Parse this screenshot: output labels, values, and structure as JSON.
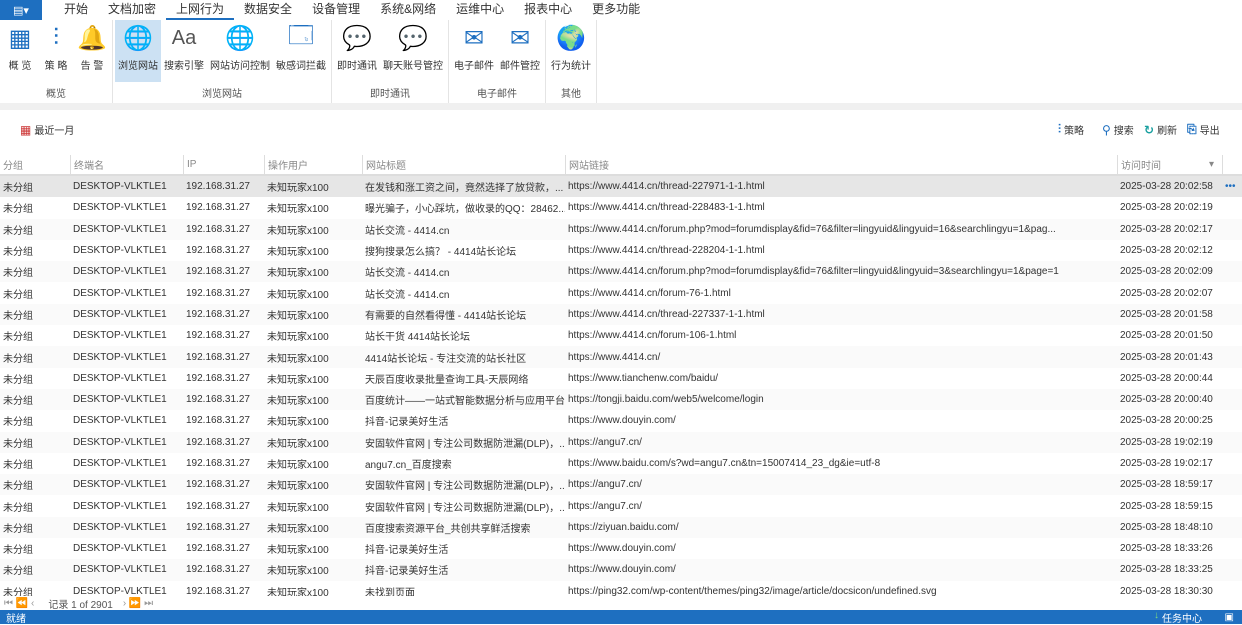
{
  "menu": {
    "items": [
      "开始",
      "文档加密",
      "上网行为",
      "数据安全",
      "设备管理",
      "系统&网络",
      "运维中心",
      "报表中心",
      "更多功能"
    ],
    "active": "上网行为"
  },
  "ribbon": {
    "groups": [
      {
        "label": "概览",
        "buttons": [
          {
            "label": "概 览",
            "icon": "grid-icon"
          },
          {
            "label": "策 略",
            "icon": "sliders-icon"
          },
          {
            "label": "告 警",
            "icon": "bell-icon"
          }
        ]
      },
      {
        "label": "浏览网站",
        "buttons": [
          {
            "label": "浏览网站",
            "icon": "globe-icon"
          },
          {
            "label": "搜索引擎",
            "icon": "font-icon"
          },
          {
            "label": "网站访问控制",
            "icon": "globe-check-icon"
          },
          {
            "label": "敏感词拦截",
            "icon": "shield-page-icon"
          }
        ]
      },
      {
        "label": "即时通讯",
        "buttons": [
          {
            "label": "即时通讯",
            "icon": "chat-icon"
          },
          {
            "label": "聊天账号管控",
            "icon": "chat-user-icon"
          }
        ]
      },
      {
        "label": "电子邮件",
        "buttons": [
          {
            "label": "电子邮件",
            "icon": "mail-icon"
          },
          {
            "label": "邮件管控",
            "icon": "mail-shield-icon"
          }
        ]
      },
      {
        "label": "其他",
        "buttons": [
          {
            "label": "行为统计",
            "icon": "stats-globe-icon"
          }
        ]
      }
    ]
  },
  "toolbar": {
    "date_range": "最近一月",
    "policy": "策略",
    "search": "搜索",
    "refresh": "刷新",
    "export": "导出"
  },
  "table": {
    "columns": [
      "分组",
      "终端名",
      "IP",
      "操作用户",
      "网站标题",
      "网站链接",
      "访问时间"
    ],
    "rows": [
      [
        "未分组",
        "DESKTOP-VLKTLE1",
        "192.168.31.27",
        "未知玩家x100",
        "在发钱和涨工资之间，竟然选择了放贷款，...",
        "https://www.4414.cn/thread-227971-1-1.html",
        "2025-03-28 20:02:58"
      ],
      [
        "未分组",
        "DESKTOP-VLKTLE1",
        "192.168.31.27",
        "未知玩家x100",
        "曝光骗子，小心踩坑，做收录的QQ：28462...",
        "https://www.4414.cn/thread-228483-1-1.html",
        "2025-03-28 20:02:19"
      ],
      [
        "未分组",
        "DESKTOP-VLKTLE1",
        "192.168.31.27",
        "未知玩家x100",
        "站长交流 - 4414.cn",
        "https://www.4414.cn/forum.php?mod=forumdisplay&fid=76&filter=lingyuid&lingyuid=16&searchlingyu=1&pag...",
        "2025-03-28 20:02:17"
      ],
      [
        "未分组",
        "DESKTOP-VLKTLE1",
        "192.168.31.27",
        "未知玩家x100",
        "搜狗搜录怎么搞？ - 4414站长论坛",
        "https://www.4414.cn/thread-228204-1-1.html",
        "2025-03-28 20:02:12"
      ],
      [
        "未分组",
        "DESKTOP-VLKTLE1",
        "192.168.31.27",
        "未知玩家x100",
        "站长交流 - 4414.cn",
        "https://www.4414.cn/forum.php?mod=forumdisplay&fid=76&filter=lingyuid&lingyuid=3&searchlingyu=1&page=1",
        "2025-03-28 20:02:09"
      ],
      [
        "未分组",
        "DESKTOP-VLKTLE1",
        "192.168.31.27",
        "未知玩家x100",
        "站长交流 - 4414.cn",
        "https://www.4414.cn/forum-76-1.html",
        "2025-03-28 20:02:07"
      ],
      [
        "未分组",
        "DESKTOP-VLKTLE1",
        "192.168.31.27",
        "未知玩家x100",
        "有需要的自然看得懂 - 4414站长论坛",
        "https://www.4414.cn/thread-227337-1-1.html",
        "2025-03-28 20:01:58"
      ],
      [
        "未分组",
        "DESKTOP-VLKTLE1",
        "192.168.31.27",
        "未知玩家x100",
        "站长干货  4414站长论坛",
        "https://www.4414.cn/forum-106-1.html",
        "2025-03-28 20:01:50"
      ],
      [
        "未分组",
        "DESKTOP-VLKTLE1",
        "192.168.31.27",
        "未知玩家x100",
        "4414站长论坛 - 专注交流的站长社区",
        "https://www.4414.cn/",
        "2025-03-28 20:01:43"
      ],
      [
        "未分组",
        "DESKTOP-VLKTLE1",
        "192.168.31.27",
        "未知玩家x100",
        "天辰百度收录批量查询工具-天辰网络",
        "https://www.tianchenw.com/baidu/",
        "2025-03-28 20:00:44"
      ],
      [
        "未分组",
        "DESKTOP-VLKTLE1",
        "192.168.31.27",
        "未知玩家x100",
        "百度统计——一站式智能数据分析与应用平台",
        "https://tongji.baidu.com/web5/welcome/login",
        "2025-03-28 20:00:40"
      ],
      [
        "未分组",
        "DESKTOP-VLKTLE1",
        "192.168.31.27",
        "未知玩家x100",
        "抖音-记录美好生活",
        "https://www.douyin.com/",
        "2025-03-28 20:00:25"
      ],
      [
        "未分组",
        "DESKTOP-VLKTLE1",
        "192.168.31.27",
        "未知玩家x100",
        "安固软件官网 | 专注公司数据防泄漏(DLP)，...",
        "https://angu7.cn/",
        "2025-03-28 19:02:19"
      ],
      [
        "未分组",
        "DESKTOP-VLKTLE1",
        "192.168.31.27",
        "未知玩家x100",
        "angu7.cn_百度搜索",
        "https://www.baidu.com/s?wd=angu7.cn&tn=15007414_23_dg&ie=utf-8",
        "2025-03-28 19:02:17"
      ],
      [
        "未分组",
        "DESKTOP-VLKTLE1",
        "192.168.31.27",
        "未知玩家x100",
        "安固软件官网 | 专注公司数据防泄漏(DLP)，...",
        "https://angu7.cn/",
        "2025-03-28 18:59:17"
      ],
      [
        "未分组",
        "DESKTOP-VLKTLE1",
        "192.168.31.27",
        "未知玩家x100",
        "安固软件官网 | 专注公司数据防泄漏(DLP)，...",
        "https://angu7.cn/",
        "2025-03-28 18:59:15"
      ],
      [
        "未分组",
        "DESKTOP-VLKTLE1",
        "192.168.31.27",
        "未知玩家x100",
        "百度搜索资源平台_共创共享鲜活搜索",
        "https://ziyuan.baidu.com/",
        "2025-03-28 18:48:10"
      ],
      [
        "未分组",
        "DESKTOP-VLKTLE1",
        "192.168.31.27",
        "未知玩家x100",
        "抖音-记录美好生活",
        "https://www.douyin.com/",
        "2025-03-28 18:33:26"
      ],
      [
        "未分组",
        "DESKTOP-VLKTLE1",
        "192.168.31.27",
        "未知玩家x100",
        "抖音-记录美好生活",
        "https://www.douyin.com/",
        "2025-03-28 18:33:25"
      ],
      [
        "未分组",
        "DESKTOP-VLKTLE1",
        "192.168.31.27",
        "未知玩家x100",
        "未找到页面",
        "https://ping32.com/wp-content/themes/ping32/image/article/docsicon/undefined.svg",
        "2025-03-28 18:30:30"
      ]
    ]
  },
  "pager": {
    "text": "记录 1 of 2901"
  },
  "status": {
    "text": "就绪",
    "task_center": "任务中心"
  },
  "colors": {
    "accent": "#1e6fc0",
    "selected_row": "#e6e6e6"
  }
}
